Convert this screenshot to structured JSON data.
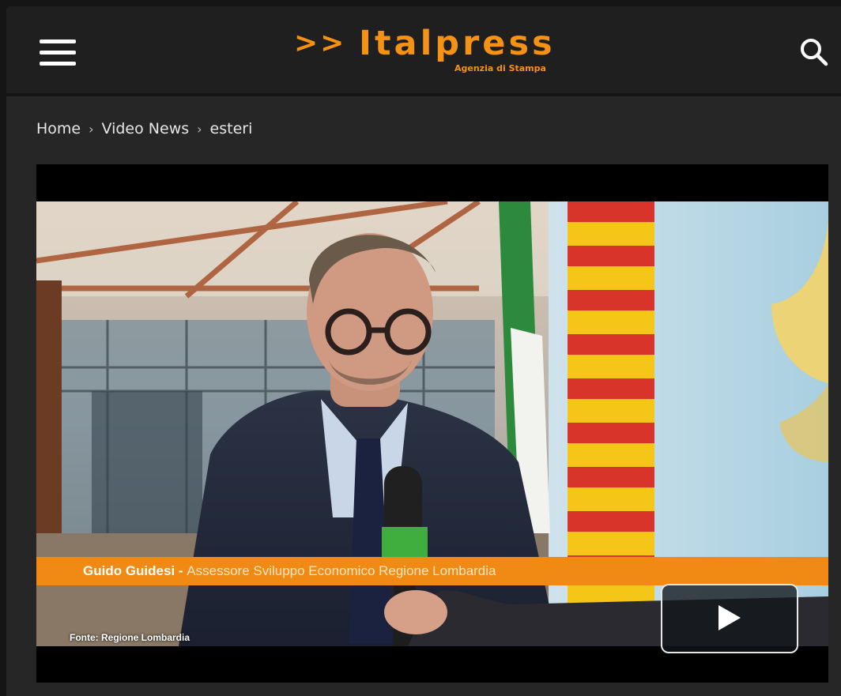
{
  "header": {
    "logo_arrows": ">>",
    "logo_word": "Italpress",
    "logo_tagline": "Agenzia di Stampa",
    "menu_icon": "hamburger-menu-icon",
    "search_icon": "search-icon",
    "accent_color": "#f39214"
  },
  "breadcrumb": {
    "items": [
      "Home",
      "Video News",
      "esteri"
    ],
    "separator": "›"
  },
  "video": {
    "lower_third_name": "Guido Guidesi - ",
    "lower_third_role": "Assessore Sviluppo Economico Regione Lombardia",
    "source_credit": "Fonte: Regione Lombardia",
    "play_icon": "play-icon",
    "overlay_color": "#f08a14"
  }
}
